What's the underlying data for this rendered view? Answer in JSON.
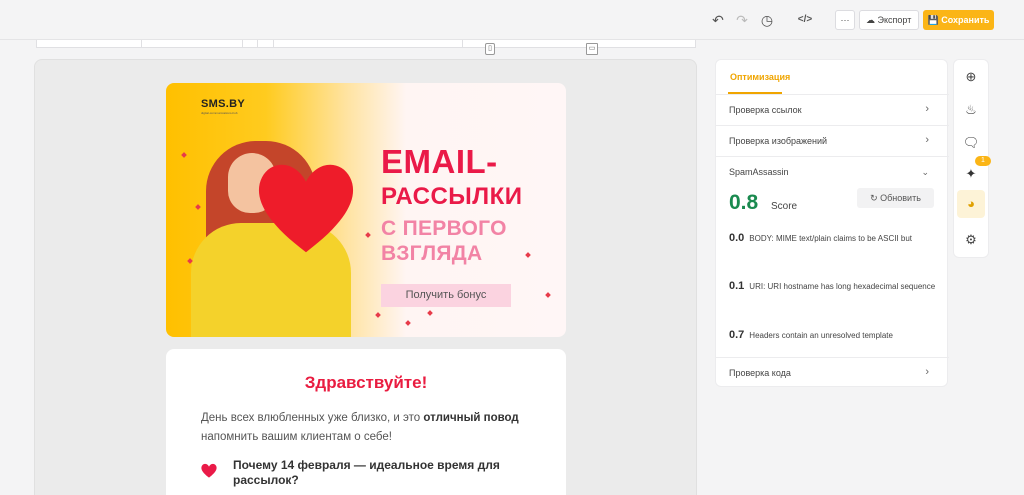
{
  "toolbar": {
    "export_label": "Экспорт",
    "save_label": "Сохранить",
    "more_label": "···",
    "code_label": "</>"
  },
  "view_toggles": {
    "mobile_label": "▯",
    "desktop_label": "▭"
  },
  "banner": {
    "logo": "SMS.BY",
    "logo_sub": "digital-communications-hub",
    "title_line1": "EMAIL-",
    "title_line2": "РАССЫЛКИ",
    "title_line3": "С ПЕРВОГО",
    "title_line4": "ВЗГЛЯДА",
    "cta_label": "Получить бонус"
  },
  "content": {
    "greeting": "Здравствуйте!",
    "para_part1": "День всех влюбленных уже близко, и это ",
    "para_bold": "отличный повод",
    "para_part2": " напомнить вашим клиентам о себе!",
    "subheading": "Почему 14 февраля — идеальное время для рассылок?"
  },
  "panel": {
    "tab_label": "Оптимизация",
    "link_check": "Проверка ссылок",
    "image_check": "Проверка изображений",
    "spam_label": "SpamAssassin",
    "score_value": "0.8",
    "score_label": "Score",
    "refresh_label": "Обновить",
    "rules": [
      {
        "score": "0.0",
        "text": "BODY: MIME text/plain claims to be ASCII but"
      },
      {
        "score": "0.1",
        "text": "URI: URI hostname has long hexadecimal sequence"
      },
      {
        "score": "0.7",
        "text": "Headers contain an unresolved template"
      }
    ],
    "code_check": "Проверка кода"
  },
  "sidebar": {
    "badge_count": "1"
  },
  "colors": {
    "accent": "#fbb516",
    "brand_red": "#ea1a48",
    "score_green": "#1a8a4f"
  }
}
